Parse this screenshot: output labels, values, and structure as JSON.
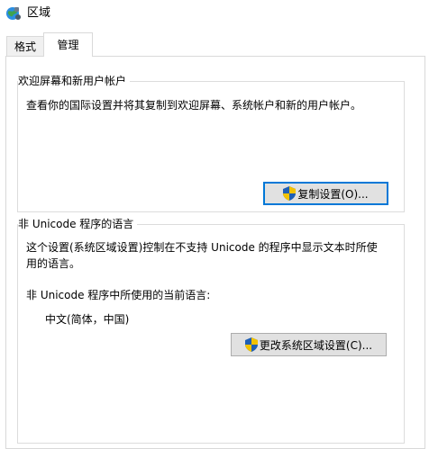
{
  "window": {
    "title": "区域"
  },
  "tabs": [
    {
      "label": "格式"
    },
    {
      "label": "管理"
    }
  ],
  "welcome": {
    "legend": "欢迎屏幕和新用户帐户",
    "description": "查看你的国际设置并将其复制到欢迎屏幕、系统帐户和新的用户帐户。",
    "copy_button": "复制设置(O)..."
  },
  "unicode": {
    "legend": "非 Unicode 程序的语言",
    "description_line1": "这个设置(系统区域设置)控制在不支持 Unicode 的程序中显示文本时所使",
    "description_line2": "用的语言。",
    "current_label": "非 Unicode 程序中所使用的当前语言:",
    "current_value": "中文(简体，中国)",
    "change_button": "更改系统区域设置(C)..."
  },
  "icons": {
    "app": "globe-icon",
    "shield": "uac-shield-icon"
  }
}
